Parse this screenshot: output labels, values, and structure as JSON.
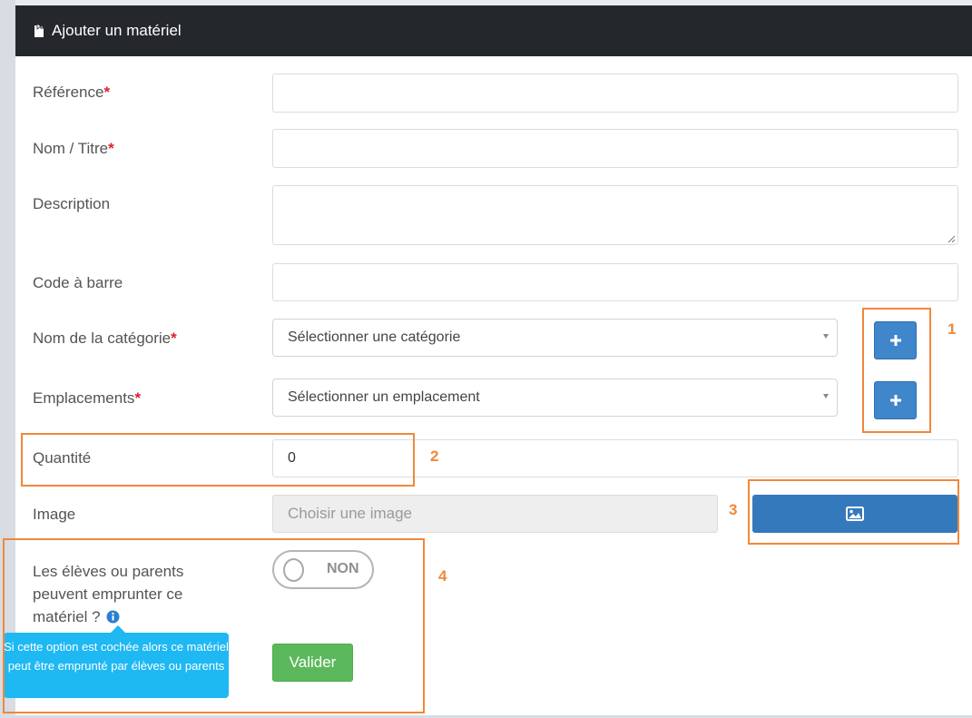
{
  "panel": {
    "title": "Ajouter un matériel",
    "header_icon": "file-import-icon"
  },
  "form": {
    "reference": {
      "label": "Référence",
      "required": "*",
      "value": ""
    },
    "name": {
      "label": "Nom / Titre",
      "required": "*",
      "value": ""
    },
    "description": {
      "label": "Description",
      "value": ""
    },
    "barcode": {
      "label": "Code à barre",
      "value": ""
    },
    "category": {
      "label": "Nom de la catégorie",
      "required": "*",
      "selected": "Sélectionner une catégorie",
      "add_icon": "plus-icon"
    },
    "location": {
      "label": "Emplacements",
      "required": "*",
      "selected": "Sélectionner un emplacement",
      "add_icon": "plus-icon"
    },
    "quantity": {
      "label": "Quantité",
      "value": "0"
    },
    "image": {
      "label": "Image",
      "placeholder": "Choisir une image",
      "button_icon": "image-icon"
    },
    "borrow": {
      "label": "Les élèves ou parents peuvent emprunter ce matériel ?",
      "toggle_text": "NON",
      "info_icon": "info-icon",
      "tooltip": "Si cette option est cochée alors ce matériel peut être emprunté par élèves ou parents"
    },
    "submit_label": "Valider"
  },
  "annotations": [
    "1",
    "2",
    "3",
    "4"
  ],
  "colors": {
    "header_bg": "#24272c",
    "primary": "#3f86cb",
    "success": "#5cb85c",
    "required": "#d9232d",
    "annotation": "#f0883a",
    "tooltip_bg": "#1eb8f3"
  }
}
